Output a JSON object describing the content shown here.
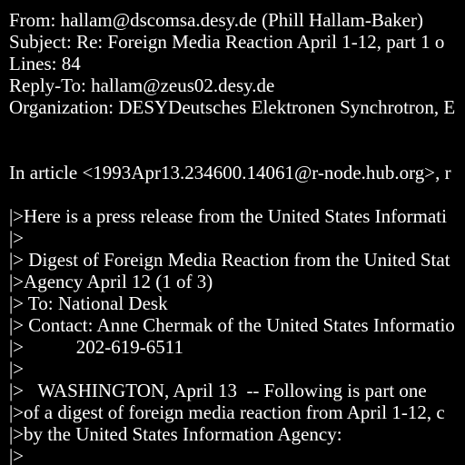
{
  "colors": {
    "background": "#000000",
    "text": "#ffffff"
  },
  "header": {
    "from": "From: hallam@dscomsa.desy.de (Phill Hallam-Baker)",
    "subject": "Subject: Re: Foreign Media Reaction April 1-12, part 1 o",
    "lines": "Lines: 84",
    "reply_to": "Reply-To: hallam@zeus02.desy.de",
    "organization": "Organization: DESYDeutsches Elektronen Synchrotron, E"
  },
  "body": {
    "attribution": "In article <1993Apr13.234600.14061@r-node.hub.org>, r",
    "quoted": [
      "|>Here is a press release from the United States Informati",
      "|>",
      "|> Digest of Foreign Media Reaction from the United Stat",
      "|>Agency April 12 (1 of 3)",
      "|> To: National Desk",
      "|> Contact: Anne Chermak of the United States Informatio",
      "|>           202-619-6511",
      "|>",
      "|>   WASHINGTON, April 13  -- Following is part one",
      "|>of a digest of foreign media reaction from April 1-12, c",
      "|>by the United States Information Agency:",
      "|>"
    ]
  }
}
